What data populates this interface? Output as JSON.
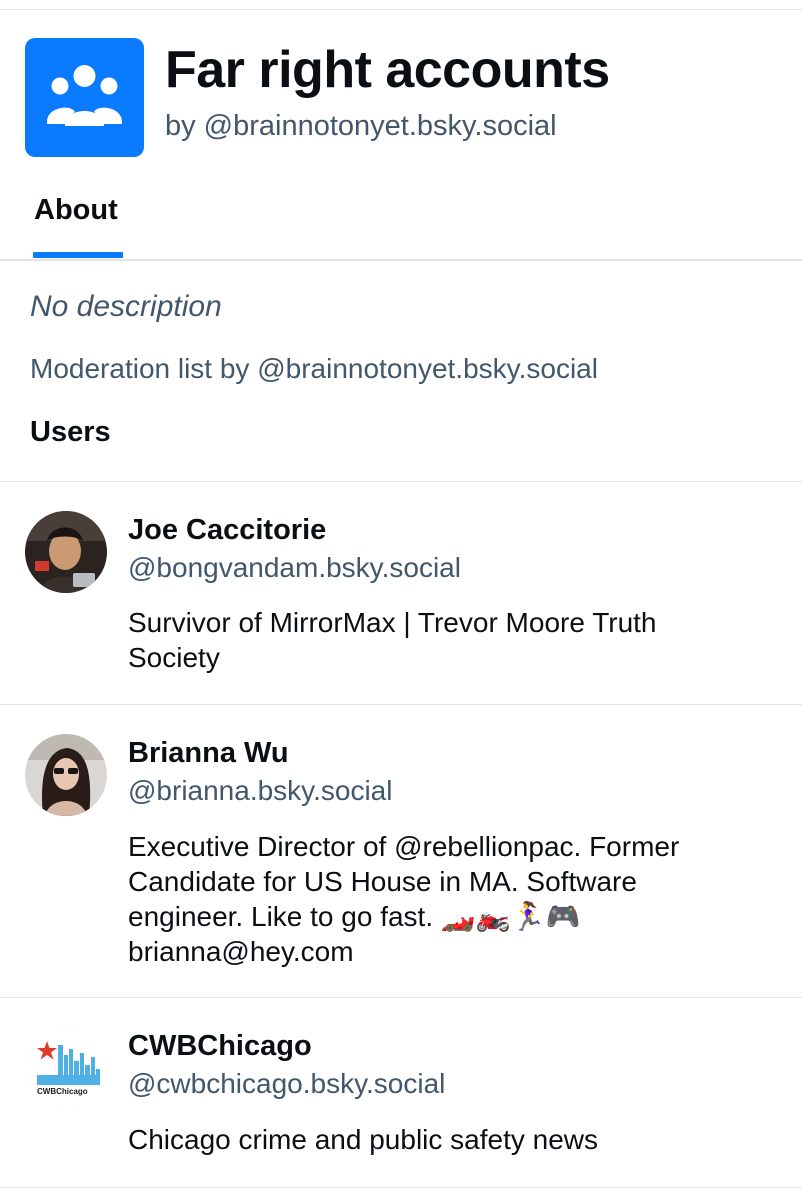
{
  "list": {
    "title": "Far right accounts",
    "byline": "by @brainnotonyet.bsky.social",
    "avatar_icon": "users-group-icon",
    "accent_color": "#0a7aff"
  },
  "tabs": [
    {
      "label": "About",
      "selected": true
    }
  ],
  "about": {
    "description": "No description",
    "moderation_by": "Moderation list by @brainnotonyet.bsky.social",
    "users_heading": "Users"
  },
  "users": [
    {
      "name": "Joe Caccitorie",
      "handle": "@bongvandam.bsky.social",
      "bio_lines": [
        "Survivor of MirrorMax | Trevor Moore Truth",
        "Society"
      ]
    },
    {
      "name": "Brianna Wu",
      "handle": "@brianna.bsky.social",
      "bio_lines": [
        "Executive Director of @rebellionpac. Former",
        "Candidate for US House in MA. Software",
        "engineer. Like to go fast. 🏎️🏍️🏃‍♀️🎮",
        "brianna@hey.com"
      ]
    },
    {
      "name": "CWBChicago",
      "handle": "@cwbchicago.bsky.social",
      "bio_lines": [
        "Chicago crime and public safety news"
      ],
      "avatar_text": "CWBChicago"
    }
  ]
}
